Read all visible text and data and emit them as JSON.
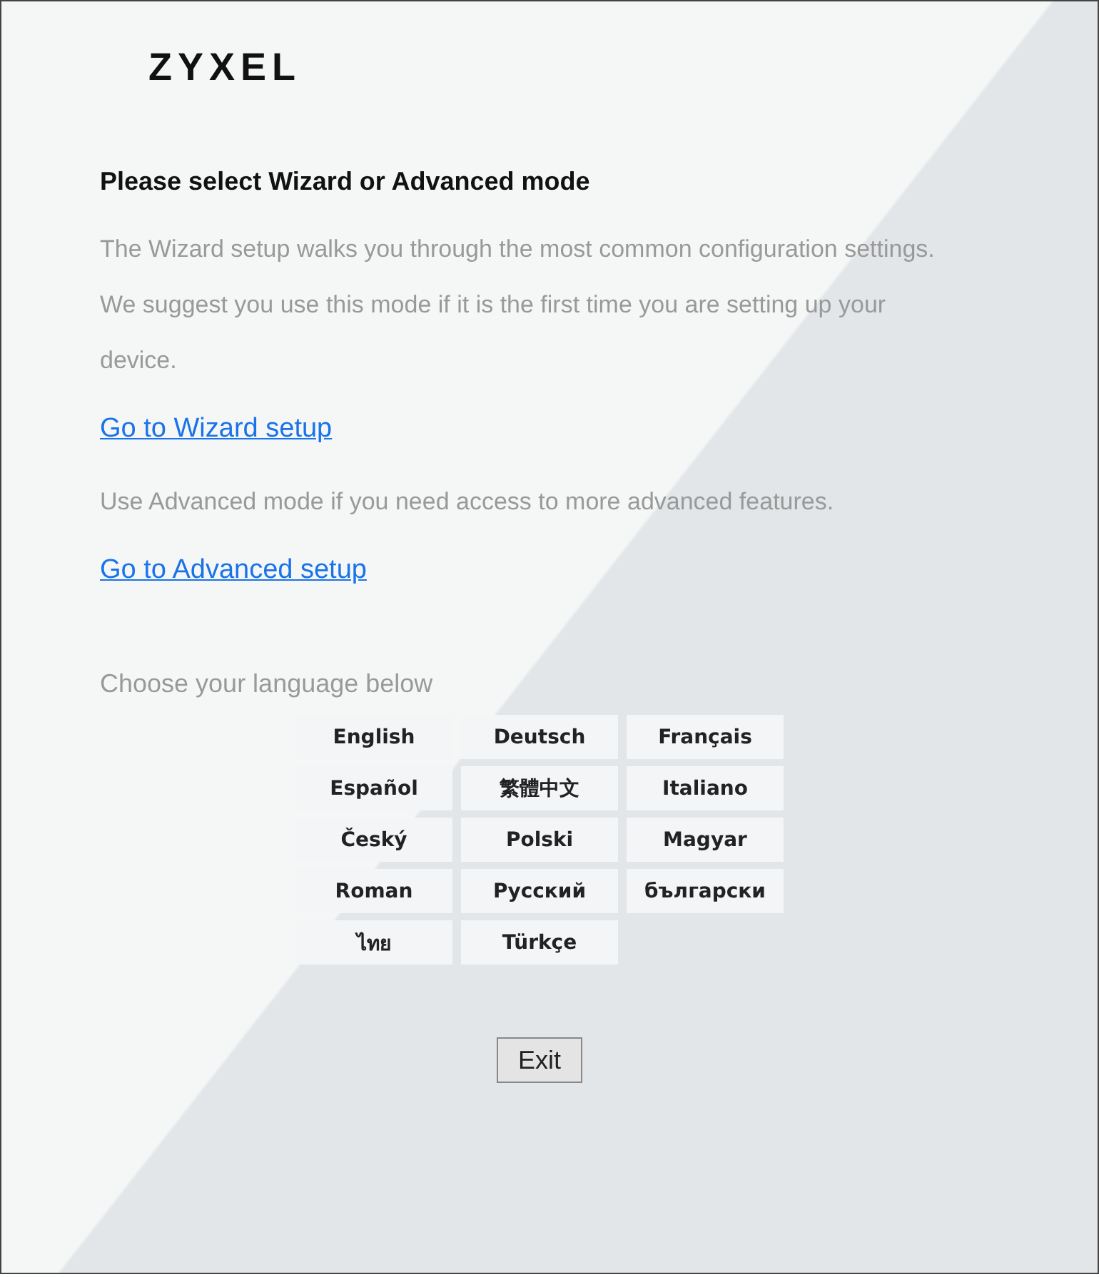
{
  "logo": "ZYXEL",
  "heading": "Please select Wizard or Advanced mode",
  "wizard_text": "The Wizard setup walks you through the most common configuration settings. We suggest you use this mode if it is the first time you are setting up your device.",
  "wizard_link": "Go to Wizard setup",
  "advanced_text": "Use Advanced mode if you need access to more advanced features.",
  "advanced_link": "Go to Advanced setup",
  "language_prompt": "Choose your language below",
  "languages": [
    "English",
    "Deutsch",
    "Français",
    "Español",
    "繁體中文",
    "Italiano",
    "Český",
    "Polski",
    "Magyar",
    "Roman",
    "Русский",
    "български",
    "ไทย",
    "Türkçe"
  ],
  "exit_button": "Exit"
}
